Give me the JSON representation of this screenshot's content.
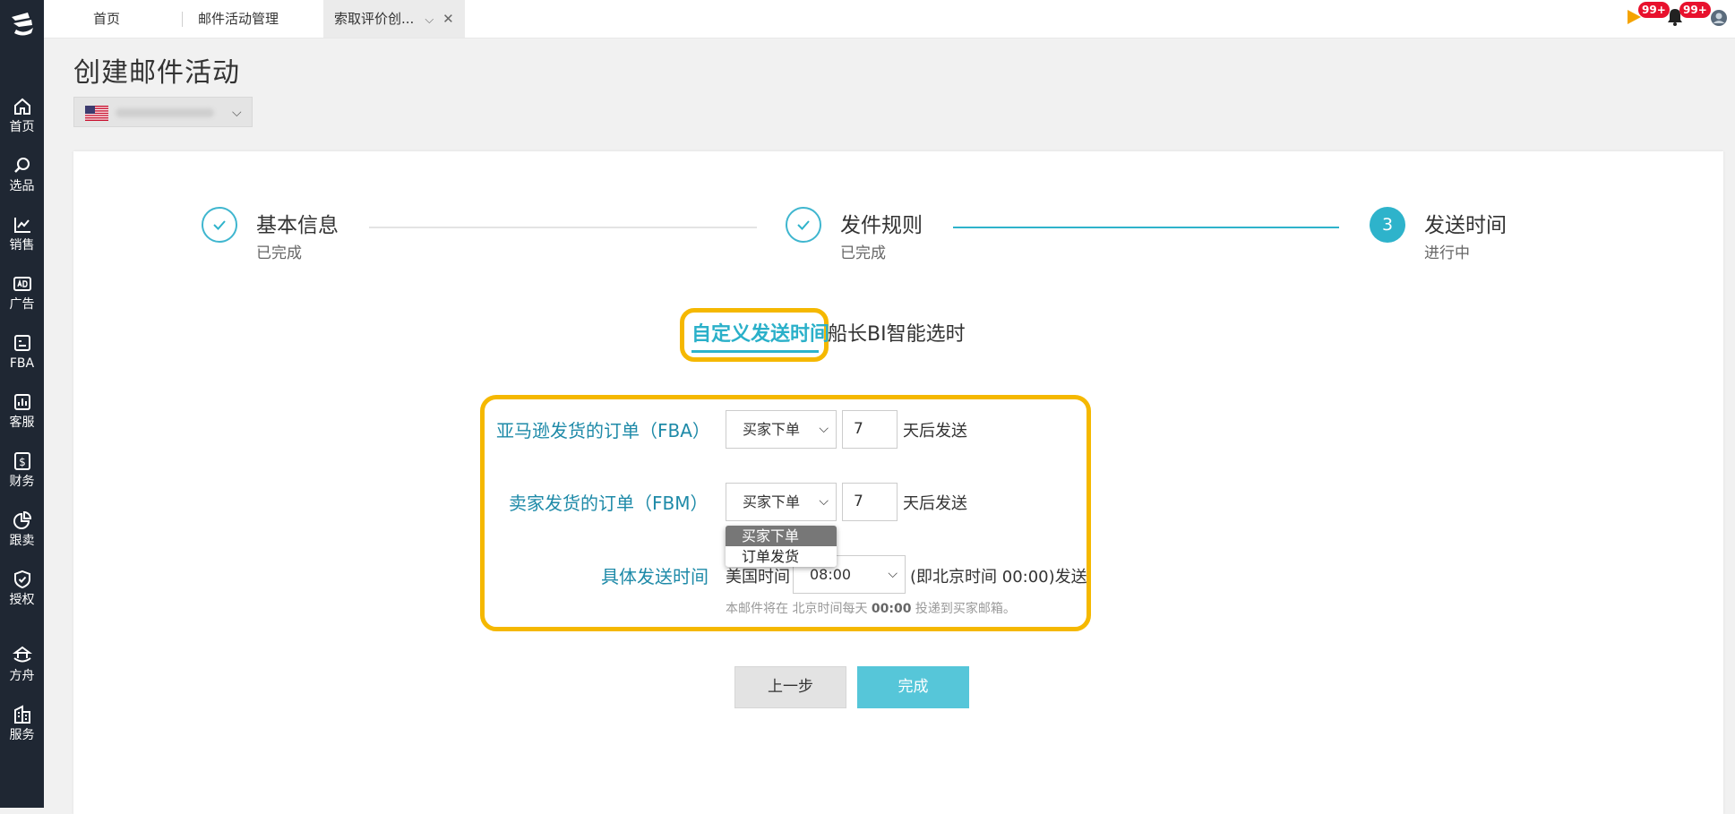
{
  "sidebar": {
    "items": [
      {
        "label": "首页",
        "icon": "home-icon"
      },
      {
        "label": "选品",
        "icon": "search-icon"
      },
      {
        "label": "销售",
        "icon": "trend-icon"
      },
      {
        "label": "广告",
        "icon": "ad-icon"
      },
      {
        "label": "FBA",
        "icon": "fba-icon"
      },
      {
        "label": "客服",
        "icon": "chart-icon"
      },
      {
        "label": "财务",
        "icon": "dollar-icon"
      },
      {
        "label": "跟卖",
        "icon": "pie-icon"
      },
      {
        "label": "授权",
        "icon": "shield-icon"
      },
      {
        "label": "方舟",
        "icon": "ark-icon"
      },
      {
        "label": "服务",
        "icon": "building-icon"
      }
    ]
  },
  "topbar": {
    "tabs": [
      {
        "label": "首页"
      },
      {
        "label": "邮件活动管理"
      },
      {
        "label": "索取评价创..."
      }
    ],
    "notif_badge_1": "99+",
    "notif_badge_2": "99+"
  },
  "page": {
    "title": "创建邮件活动"
  },
  "steps": [
    {
      "title": "基本信息",
      "status": "已完成"
    },
    {
      "title": "发件规则",
      "status": "已完成"
    },
    {
      "number": "3",
      "title": "发送时间",
      "status": "进行中"
    }
  ],
  "mode_tabs": {
    "custom": "自定义发送时间",
    "bi": "船长BI智能选时"
  },
  "form": {
    "fba": {
      "label": "亚马逊发货的订单（FBA）",
      "trigger": "买家下单",
      "days": "7",
      "suffix": "天后发送"
    },
    "fbm": {
      "label": "卖家发货的订单（FBM）",
      "trigger": "买家下单",
      "days": "7",
      "suffix": "天后发送"
    },
    "dropdown_options": [
      "买家下单",
      "订单发货"
    ],
    "send_time": {
      "label": "具体发送时间",
      "zone": "美国时间",
      "time": "08:00",
      "beijing_note": "(即北京时间 00:00)发送"
    },
    "hint": {
      "prefix": "本邮件将在 北京时间每天 ",
      "time": "00:00",
      "suffix": " 投递到买家邮箱。"
    }
  },
  "buttons": {
    "prev": "上一步",
    "done": "完成"
  },
  "colors": {
    "accent": "#2eb3cb",
    "highlight": "#f5b800",
    "sidebar": "#1f2733",
    "badge": "#e8112d"
  }
}
